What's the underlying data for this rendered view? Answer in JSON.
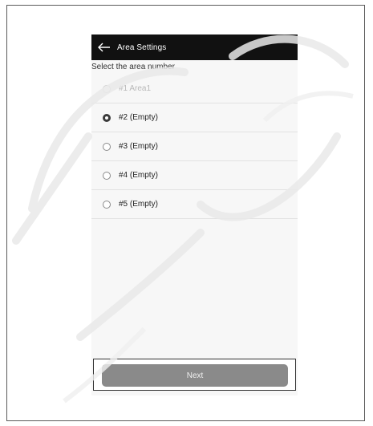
{
  "app": {
    "title": "Area Settings"
  },
  "prompt": "Select the area number",
  "areas": [
    {
      "label": "#1 Area1",
      "state": "disabled"
    },
    {
      "label": "#2 (Empty)",
      "state": "selected"
    },
    {
      "label": "#3 (Empty)",
      "state": "unselected"
    },
    {
      "label": "#4 (Empty)",
      "state": "unselected"
    },
    {
      "label": "#5 (Empty)",
      "state": "unselected"
    }
  ],
  "footer": {
    "next_label": "Next"
  },
  "icons": {
    "back": "arrow-left-icon"
  },
  "colors": {
    "appbar": "#111111",
    "button": "#8a8a8a",
    "selected_radio": "#3a3a3a"
  }
}
